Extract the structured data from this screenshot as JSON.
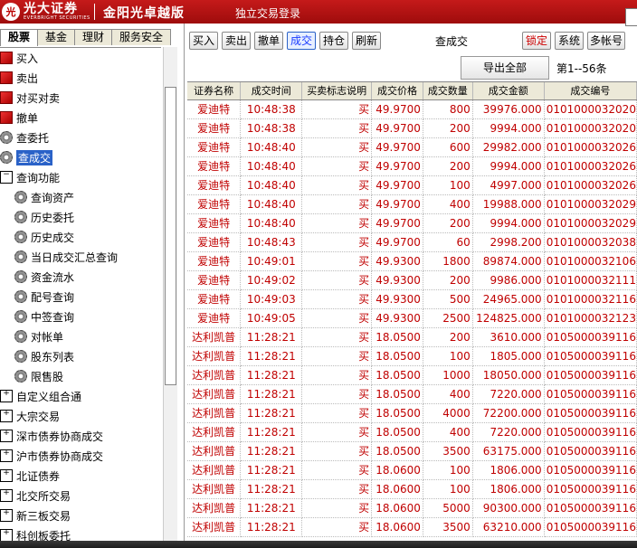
{
  "app": {
    "logo_mark": "光",
    "logo_text": "光大证券",
    "logo_sub": "EVERBRIGHT SECURITIES",
    "edition": "金阳光卓越版",
    "subtitle": "独立交易登录"
  },
  "left_tabs": [
    {
      "label": "股票",
      "active": true
    },
    {
      "label": "基金",
      "active": false
    },
    {
      "label": "理财",
      "active": false
    },
    {
      "label": "服务安全",
      "active": false
    }
  ],
  "tree": [
    {
      "label": "买入",
      "icon": "order-icon",
      "indent": 0,
      "type": "leaf"
    },
    {
      "label": "卖出",
      "icon": "order-icon",
      "indent": 0,
      "type": "leaf"
    },
    {
      "label": "对买对卖",
      "icon": "order-icon",
      "indent": 0,
      "type": "leaf"
    },
    {
      "label": "撤单",
      "icon": "order-icon",
      "indent": 0,
      "type": "leaf"
    },
    {
      "label": "查委托",
      "icon": "gear-icon",
      "indent": 0,
      "type": "leaf"
    },
    {
      "label": "查成交",
      "icon": "gear-icon",
      "indent": 0,
      "type": "leaf",
      "selected": true
    },
    {
      "label": "查询功能",
      "icon": "collapse-icon",
      "indent": 0,
      "type": "folder-open"
    },
    {
      "label": "查询资产",
      "icon": "gear-icon",
      "indent": 1,
      "type": "leaf"
    },
    {
      "label": "历史委托",
      "icon": "gear-icon",
      "indent": 1,
      "type": "leaf"
    },
    {
      "label": "历史成交",
      "icon": "gear-icon",
      "indent": 1,
      "type": "leaf"
    },
    {
      "label": "当日成交汇总查询",
      "icon": "gear-icon",
      "indent": 1,
      "type": "leaf"
    },
    {
      "label": "资金流水",
      "icon": "gear-icon",
      "indent": 1,
      "type": "leaf"
    },
    {
      "label": "配号查询",
      "icon": "gear-icon",
      "indent": 1,
      "type": "leaf"
    },
    {
      "label": "中签查询",
      "icon": "gear-icon",
      "indent": 1,
      "type": "leaf"
    },
    {
      "label": "对帐单",
      "icon": "gear-icon",
      "indent": 1,
      "type": "leaf"
    },
    {
      "label": "股东列表",
      "icon": "gear-icon",
      "indent": 1,
      "type": "leaf"
    },
    {
      "label": "限售股",
      "icon": "gear-icon",
      "indent": 1,
      "type": "leaf"
    },
    {
      "label": "自定义组合通",
      "icon": "expand-icon",
      "indent": 0,
      "type": "folder"
    },
    {
      "label": "大宗交易",
      "icon": "expand-icon",
      "indent": 0,
      "type": "folder"
    },
    {
      "label": "深市债券协商成交",
      "icon": "expand-icon",
      "indent": 0,
      "type": "folder"
    },
    {
      "label": "沪市债券协商成交",
      "icon": "expand-icon",
      "indent": 0,
      "type": "folder"
    },
    {
      "label": "北证债券",
      "icon": "expand-icon",
      "indent": 0,
      "type": "folder"
    },
    {
      "label": "北交所交易",
      "icon": "expand-icon",
      "indent": 0,
      "type": "folder"
    },
    {
      "label": "新三板交易",
      "icon": "expand-icon",
      "indent": 0,
      "type": "folder"
    },
    {
      "label": "科创板委托",
      "icon": "expand-icon",
      "indent": 0,
      "type": "folder"
    }
  ],
  "toolbar": {
    "buttons": [
      {
        "label": "买入",
        "name": "buy-button"
      },
      {
        "label": "卖出",
        "name": "sell-button"
      },
      {
        "label": "撤单",
        "name": "cancel-order-button"
      },
      {
        "label": "成交",
        "name": "trades-button",
        "active": true
      },
      {
        "label": "持仓",
        "name": "positions-button"
      },
      {
        "label": "刷新",
        "name": "refresh-button"
      }
    ],
    "title": "查成交",
    "right_buttons": [
      {
        "label": "锁定",
        "name": "lock-button"
      },
      {
        "label": "系统",
        "name": "system-button"
      },
      {
        "label": "多帐号",
        "name": "multi-account-button"
      }
    ]
  },
  "export_label": "导出全部",
  "count_label": "第1--56条",
  "table": {
    "columns": [
      "证券名称",
      "成交时间",
      "买卖标志说明",
      "成交价格",
      "成交数量",
      "成交金额",
      "成交编号"
    ],
    "rows": [
      [
        "爱迪特",
        "10:48:38",
        "买",
        "49.9700",
        "800",
        "39976.000",
        "0101000032020"
      ],
      [
        "爱迪特",
        "10:48:38",
        "买",
        "49.9700",
        "200",
        "9994.000",
        "0101000032020"
      ],
      [
        "爱迪特",
        "10:48:40",
        "买",
        "49.9700",
        "600",
        "29982.000",
        "0101000032026"
      ],
      [
        "爱迪特",
        "10:48:40",
        "买",
        "49.9700",
        "200",
        "9994.000",
        "0101000032026"
      ],
      [
        "爱迪特",
        "10:48:40",
        "买",
        "49.9700",
        "100",
        "4997.000",
        "0101000032026"
      ],
      [
        "爱迪特",
        "10:48:40",
        "买",
        "49.9700",
        "400",
        "19988.000",
        "0101000032029"
      ],
      [
        "爱迪特",
        "10:48:40",
        "买",
        "49.9700",
        "200",
        "9994.000",
        "0101000032029"
      ],
      [
        "爱迪特",
        "10:48:43",
        "买",
        "49.9700",
        "60",
        "2998.200",
        "0101000032038"
      ],
      [
        "爱迪特",
        "10:49:01",
        "买",
        "49.9300",
        "1800",
        "89874.000",
        "0101000032106"
      ],
      [
        "爱迪特",
        "10:49:02",
        "买",
        "49.9300",
        "200",
        "9986.000",
        "0101000032111"
      ],
      [
        "爱迪特",
        "10:49:03",
        "买",
        "49.9300",
        "500",
        "24965.000",
        "0101000032116"
      ],
      [
        "爱迪特",
        "10:49:05",
        "买",
        "49.9300",
        "2500",
        "124825.000",
        "0101000032123"
      ],
      [
        "达利凯普",
        "11:28:21",
        "买",
        "18.0500",
        "200",
        "3610.000",
        "0105000039116"
      ],
      [
        "达利凯普",
        "11:28:21",
        "买",
        "18.0500",
        "100",
        "1805.000",
        "0105000039116"
      ],
      [
        "达利凯普",
        "11:28:21",
        "买",
        "18.0500",
        "1000",
        "18050.000",
        "0105000039116"
      ],
      [
        "达利凯普",
        "11:28:21",
        "买",
        "18.0500",
        "400",
        "7220.000",
        "0105000039116"
      ],
      [
        "达利凯普",
        "11:28:21",
        "买",
        "18.0500",
        "4000",
        "72200.000",
        "0105000039116"
      ],
      [
        "达利凯普",
        "11:28:21",
        "买",
        "18.0500",
        "400",
        "7220.000",
        "0105000039116"
      ],
      [
        "达利凯普",
        "11:28:21",
        "买",
        "18.0500",
        "3500",
        "63175.000",
        "0105000039116"
      ],
      [
        "达利凯普",
        "11:28:21",
        "买",
        "18.0600",
        "100",
        "1806.000",
        "0105000039116"
      ],
      [
        "达利凯普",
        "11:28:21",
        "买",
        "18.0600",
        "100",
        "1806.000",
        "0105000039116"
      ],
      [
        "达利凯普",
        "11:28:21",
        "买",
        "18.0600",
        "5000",
        "90300.000",
        "0105000039116"
      ],
      [
        "达利凯普",
        "11:28:21",
        "买",
        "18.0600",
        "3500",
        "63210.000",
        "0105000039116"
      ]
    ]
  },
  "colors": {
    "titlebar": "#b31212",
    "row_text": "#c00000",
    "selected": "#2a62c8"
  }
}
